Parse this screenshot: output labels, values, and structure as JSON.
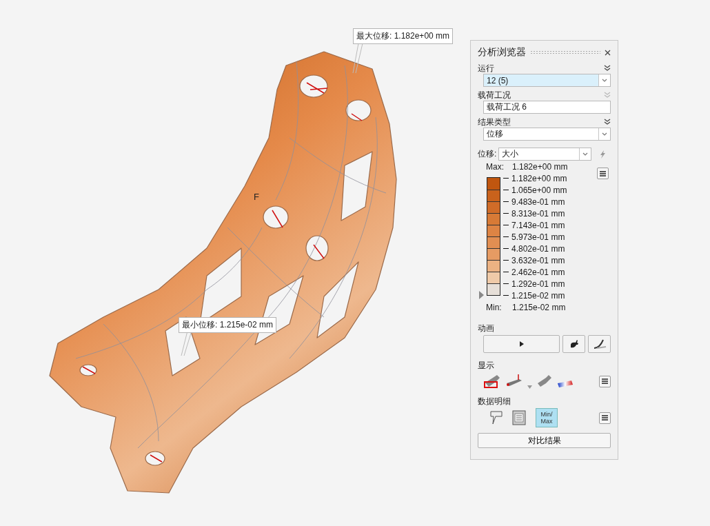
{
  "viewport": {
    "model_label": "F",
    "max_callout": "最大位移: 1.182e+00 mm",
    "min_callout": "最小位移: 1.215e-02 mm"
  },
  "panel": {
    "title": "分析浏览器",
    "run": {
      "label": "运行",
      "value": "12 (5)",
      "selected": true,
      "expand_disabled": false
    },
    "load_case": {
      "label": "载荷工况",
      "value": "载荷工况 6",
      "expand_disabled": true
    },
    "result_type": {
      "label": "结果类型",
      "value": "位移",
      "expand_disabled": false
    },
    "component": {
      "label": "位移:",
      "value": "大小"
    },
    "legend": {
      "max_label": "Max:",
      "max_value": "1.182e+00 mm",
      "min_label": "Min:",
      "min_value": "1.215e-02 mm",
      "bands": [
        {
          "color": "#c0560f"
        },
        {
          "color": "#c9621c"
        },
        {
          "color": "#d06c28"
        },
        {
          "color": "#d77a36"
        },
        {
          "color": "#dd8444"
        },
        {
          "color": "#e18e52"
        },
        {
          "color": "#e69b63"
        },
        {
          "color": "#ebb283"
        },
        {
          "color": "#efcaa8"
        },
        {
          "color": "#e6dfd8"
        }
      ],
      "ticks": [
        "1.182e+00 mm",
        "1.065e+00 mm",
        "9.483e-01 mm",
        "8.313e-01 mm",
        "7.143e-01 mm",
        "5.973e-01 mm",
        "4.802e-01 mm",
        "3.632e-01 mm",
        "2.462e-01 mm",
        "1.292e-01 mm",
        "1.215e-02 mm"
      ]
    },
    "animation": {
      "label": "动画"
    },
    "display": {
      "label": "显示"
    },
    "data_detail": {
      "label": "数据明细",
      "minmax": {
        "lines": [
          "Min/",
          "Max"
        ],
        "selected": true
      }
    },
    "compare_button": "对比结果"
  }
}
